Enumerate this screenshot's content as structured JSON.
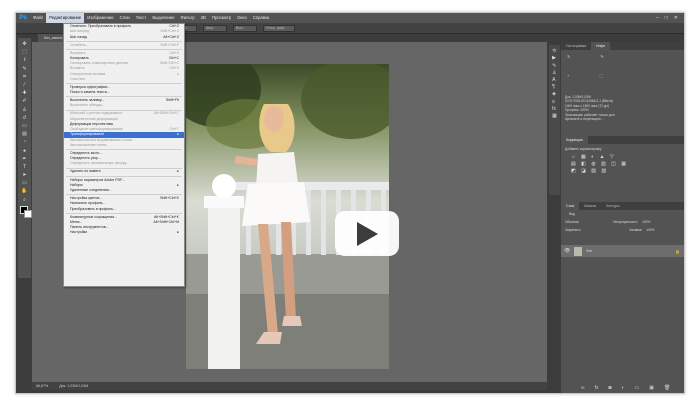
{
  "menubar": {
    "logo": "Ps",
    "items": [
      "Файл",
      "Редактирование",
      "Изображение",
      "Слои",
      "Текст",
      "Выделение",
      "Фильтр",
      "3D",
      "Просмотр",
      "Окно",
      "Справка"
    ],
    "active_index": 1,
    "window_controls": [
      "–",
      "□",
      "✕"
    ]
  },
  "options": {
    "style_label": "Обычный",
    "width_placeholder": "Шир.:",
    "height_placeholder": "Выс.:",
    "refine_label": "Уточн. край..."
  },
  "document": {
    "tab_label": "Без_имени"
  },
  "status": {
    "zoom": "66,67%",
    "doc": "Док: 1,03М/1,03М"
  },
  "edit_menu": {
    "rows": [
      {
        "label": "Отменить: Преобразовать в профиль",
        "shortcut": "Ctrl+Z",
        "state": "normal"
      },
      {
        "label": "Шаг вперед",
        "shortcut": "Shift+Ctrl+Z",
        "state": "disabled"
      },
      {
        "label": "Шаг назад",
        "shortcut": "Alt+Ctrl+Z",
        "state": "normal"
      },
      {
        "sep": true
      },
      {
        "label": "Ослабить...",
        "shortcut": "Shift+Ctrl+F",
        "state": "disabled"
      },
      {
        "sep": true
      },
      {
        "label": "Вырезать",
        "shortcut": "Ctrl+X",
        "state": "disabled"
      },
      {
        "label": "Копировать",
        "shortcut": "Ctrl+C",
        "state": "normal"
      },
      {
        "label": "Скопировать совмещенные данные",
        "shortcut": "Shift+Ctrl+C",
        "state": "disabled"
      },
      {
        "label": "Вставить",
        "shortcut": "Ctrl+V",
        "state": "disabled"
      },
      {
        "label": "Специальная вставка",
        "shortcut": "▸",
        "state": "disabled"
      },
      {
        "label": "Очистить",
        "shortcut": "",
        "state": "disabled"
      },
      {
        "sep": true
      },
      {
        "label": "Проверка орфографии...",
        "shortcut": "",
        "state": "normal"
      },
      {
        "label": "Поиск и замена текста...",
        "shortcut": "",
        "state": "normal"
      },
      {
        "sep": true
      },
      {
        "label": "Выполнить заливку...",
        "shortcut": "Shift+F5",
        "state": "normal"
      },
      {
        "label": "Выполнить обводку...",
        "shortcut": "",
        "state": "disabled"
      },
      {
        "sep": true
      },
      {
        "label": "Масштаб с учетом содержимого",
        "shortcut": "Alt+Shift+Ctrl+C",
        "state": "disabled"
      },
      {
        "label": "Марионеточная деформация",
        "shortcut": "",
        "state": "disabled"
      },
      {
        "label": "Деформация перспективы",
        "shortcut": "",
        "state": "normal"
      },
      {
        "label": "Свободное трансформирование",
        "shortcut": "Ctrl+T",
        "state": "disabled"
      },
      {
        "label": "Трансформирование",
        "shortcut": "▸",
        "state": "highlighted"
      },
      {
        "label": "Автоматическое выравнивание слоев...",
        "shortcut": "",
        "state": "disabled"
      },
      {
        "label": "Автоналожение слоев...",
        "shortcut": "",
        "state": "disabled"
      },
      {
        "sep": true
      },
      {
        "label": "Определить кисть...",
        "shortcut": "",
        "state": "normal"
      },
      {
        "label": "Определить узор...",
        "shortcut": "",
        "state": "normal"
      },
      {
        "label": "Определить произвольную фигуру...",
        "shortcut": "",
        "state": "disabled"
      },
      {
        "sep": true
      },
      {
        "label": "Удалить из памяти",
        "shortcut": "▸",
        "state": "normal"
      },
      {
        "sep": true
      },
      {
        "label": "Наборы параметров Adobe PDF...",
        "shortcut": "",
        "state": "normal"
      },
      {
        "label": "Наборы",
        "shortcut": "▸",
        "state": "normal"
      },
      {
        "label": "Удаленные соединения...",
        "shortcut": "",
        "state": "normal"
      },
      {
        "sep": true
      },
      {
        "label": "Настройка цветов...",
        "shortcut": "Shift+Ctrl+K",
        "state": "normal"
      },
      {
        "label": "Назначить профиль...",
        "shortcut": "",
        "state": "normal"
      },
      {
        "label": "Преобразовать в профиль...",
        "shortcut": "",
        "state": "normal"
      },
      {
        "sep": true
      },
      {
        "label": "Клавиатурные сокращения...",
        "shortcut": "Alt+Shift+Ctrl+K",
        "state": "normal"
      },
      {
        "label": "Меню...",
        "shortcut": "Alt+Shift+Ctrl+M",
        "state": "normal"
      },
      {
        "label": "Панель инструментов...",
        "shortcut": "",
        "state": "normal"
      },
      {
        "label": "Настройки",
        "shortcut": "▸",
        "state": "normal"
      }
    ]
  },
  "panels": {
    "info_tabs": [
      "Гистограмма",
      "Инфо"
    ],
    "info_lines": [
      "Док: 1,03М/1,03М",
      "ICCE RGB IEC61966-2.1 (8бит/к)",
      "1000 пикс x 1500 пикс (72 ppi)",
      "Прогресс: 100%",
      "Экспозиция: работает только для",
      "Щелкните и перетащите..."
    ],
    "adjust_tab": "Коррекция",
    "adjust_label": "Добавить корректировку",
    "layers_tabs": [
      "Слои",
      "Каналы",
      "Контуры"
    ],
    "layers_kind": "Вид",
    "blend_mode": "Обычные",
    "opacity_label": "Непрозрачность:",
    "opacity_value": "100%",
    "fill_label": "Заливка:",
    "fill_value": "100%",
    "lock_label": "Закрепить:",
    "layer_name": "Фон"
  },
  "toolbar": {
    "icons": [
      "move-icon",
      "marquee-icon",
      "lasso-icon",
      "quick-select-icon",
      "crop-icon",
      "eyedropper-icon",
      "heal-icon",
      "brush-icon",
      "stamp-icon",
      "history-brush-icon",
      "eraser-icon",
      "gradient-icon",
      "blur-icon",
      "dodge-icon",
      "pen-icon",
      "type-icon",
      "path-select-icon",
      "shape-icon",
      "hand-icon",
      "zoom-icon"
    ]
  },
  "dock": {
    "icons": [
      "history-icon",
      "play-icon",
      "brush-panel-icon",
      "clone-source-icon",
      "character-icon",
      "paragraph-icon",
      "3d-icon",
      "properties-icon",
      "styles-icon",
      "swatches-icon"
    ]
  },
  "colors": {
    "accent": "#3b6fd0",
    "app_bg": "#535353",
    "canvas": "#666666"
  }
}
